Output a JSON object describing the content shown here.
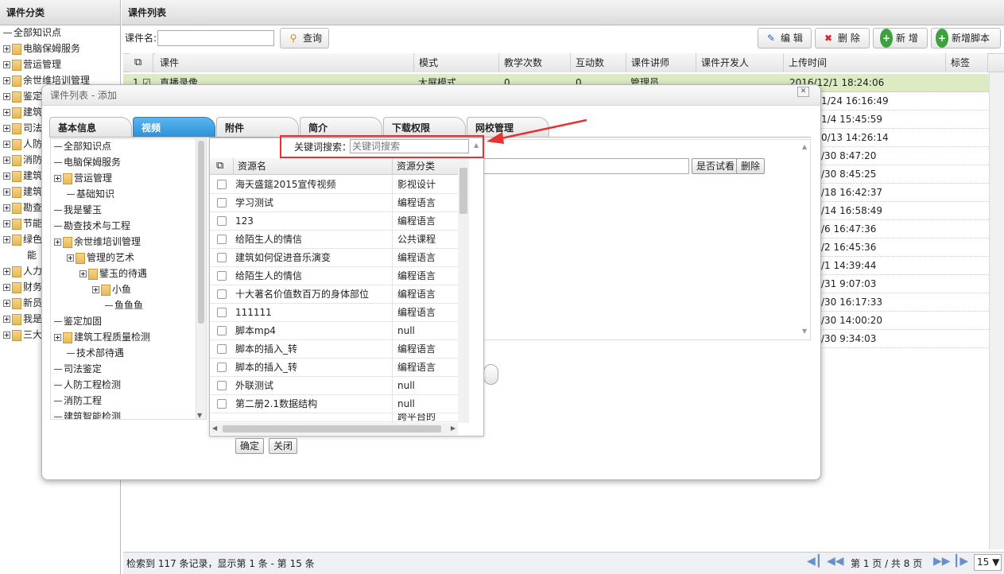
{
  "left_panel": {
    "title": "课件分类",
    "items": [
      {
        "label": "全部知识点",
        "expand": false,
        "folder": false
      },
      {
        "label": "电脑保姆服务",
        "expand": true,
        "folder": true
      },
      {
        "label": "营运管理",
        "expand": true,
        "folder": true
      },
      {
        "label": "余世维培训管理",
        "expand": true,
        "folder": true
      },
      {
        "label": "鉴定",
        "expand": true,
        "folder": true
      },
      {
        "label": "建筑",
        "expand": true,
        "folder": true
      },
      {
        "label": "司法",
        "expand": true,
        "folder": true
      },
      {
        "label": "人防",
        "expand": true,
        "folder": true
      },
      {
        "label": "消防",
        "expand": true,
        "folder": true
      },
      {
        "label": "建筑",
        "expand": true,
        "folder": true
      },
      {
        "label": "建筑",
        "expand": true,
        "folder": true
      },
      {
        "label": "勘查",
        "expand": true,
        "folder": true
      },
      {
        "label": "节能",
        "expand": true,
        "folder": true
      },
      {
        "label": "绿色",
        "expand": true,
        "folder": true
      },
      {
        "label": "能",
        "expand": false,
        "folder": false
      },
      {
        "label": "人力",
        "expand": true,
        "folder": true
      },
      {
        "label": "财务",
        "expand": true,
        "folder": true
      },
      {
        "label": "新员",
        "expand": true,
        "folder": true
      },
      {
        "label": "我是",
        "expand": true,
        "folder": true
      },
      {
        "label": "三大",
        "expand": true,
        "folder": true
      }
    ]
  },
  "main": {
    "title": "课件列表",
    "search_label": "课件名:",
    "search_value": "",
    "search_button": "查询",
    "toolbar": {
      "edit": "编 辑",
      "delete": "删 除",
      "add": "新 增",
      "add_script": "新增脚本"
    },
    "columns": [
      "课件",
      "模式",
      "教学次数",
      "互动数",
      "课件讲师",
      "课件开发人",
      "上传时间",
      "标签"
    ],
    "first_row": {
      "num": "1",
      "name": "直播录像",
      "mode": "大屏模式",
      "teach": "0",
      "interact": "0",
      "lecturer": "管理员"
    },
    "upload_times": [
      "2016/12/1 18:24:06",
      "1/24 16:16:49",
      "1/4 15:45:59",
      "0/13 14:26:14",
      "/30 8:47:20",
      "/30 8:45:25",
      "/18 16:42:37",
      "/14 16:58:49",
      "/6 16:47:36",
      "/2 16:45:36",
      "/1 14:39:44",
      "/31 9:07:03",
      "/30 16:17:33",
      "/30 14:00:20",
      "/30 9:34:03"
    ],
    "footer_text": "检索到 117 条记录，显示第 1 条 - 第 15 条",
    "pager_text": "第 1 页 / 共 8 页",
    "page_size": "15"
  },
  "dialog": {
    "title": "课件列表 - 添加",
    "tabs": [
      "基本信息",
      "视频",
      "附件",
      "简介",
      "下载权限",
      "网校管理"
    ],
    "tree": [
      {
        "label": "全部知识点",
        "expand": false,
        "folder": false,
        "level": 0
      },
      {
        "label": "电脑保姆服务",
        "expand": false,
        "folder": false,
        "level": 0
      },
      {
        "label": "营运管理",
        "expand": true,
        "folder": true,
        "level": 0
      },
      {
        "label": "基础知识",
        "expand": false,
        "folder": false,
        "level": 1
      },
      {
        "label": "我是鐾玉",
        "expand": false,
        "folder": false,
        "level": 0
      },
      {
        "label": "勘查技术与工程",
        "expand": false,
        "folder": false,
        "level": 0
      },
      {
        "label": "余世维培训管理",
        "expand": true,
        "folder": true,
        "level": 0
      },
      {
        "label": "管理的艺术",
        "expand": true,
        "folder": true,
        "level": 1
      },
      {
        "label": "鐾玉的待遇",
        "expand": true,
        "folder": true,
        "level": 2
      },
      {
        "label": "小鱼",
        "expand": true,
        "folder": true,
        "level": 3
      },
      {
        "label": "鱼鱼鱼",
        "expand": false,
        "folder": false,
        "level": 4
      },
      {
        "label": "鉴定加固",
        "expand": false,
        "folder": false,
        "level": 0
      },
      {
        "label": "建筑工程质量检测",
        "expand": true,
        "folder": true,
        "level": 0
      },
      {
        "label": "技术部待遇",
        "expand": false,
        "folder": false,
        "level": 1
      },
      {
        "label": "司法鉴定",
        "expand": false,
        "folder": false,
        "level": 0
      },
      {
        "label": "人防工程检测",
        "expand": false,
        "folder": false,
        "level": 0
      },
      {
        "label": "消防工程",
        "expand": false,
        "folder": false,
        "level": 0
      },
      {
        "label": "建筑智能检测",
        "expand": false,
        "folder": false,
        "level": 0
      }
    ],
    "keyword_label": "关键词搜索：",
    "keyword_placeholder": "关键词搜索",
    "resource_columns": [
      "资源名",
      "资源分类"
    ],
    "resources": [
      {
        "name": "海天盛筵2015宣传视频",
        "cat": "影视设计"
      },
      {
        "name": "学习测试",
        "cat": "编程语言"
      },
      {
        "name": "123",
        "cat": "编程语言"
      },
      {
        "name": "给陌生人的情信",
        "cat": "公共课程"
      },
      {
        "name": "建筑如何促进音乐演变",
        "cat": "编程语言"
      },
      {
        "name": "给陌生人的情信",
        "cat": "编程语言"
      },
      {
        "name": "十大著名价值数百万的身体部位",
        "cat": "编程语言"
      },
      {
        "name": "111111",
        "cat": "编程语言"
      },
      {
        "name": "脚本mp4",
        "cat": "null"
      },
      {
        "name": "脚本的插入_转",
        "cat": "编程语言"
      },
      {
        "name": "脚本的插入_转",
        "cat": "编程语言"
      },
      {
        "name": "外联测试",
        "cat": "null"
      },
      {
        "name": "第二册2.1数据结构",
        "cat": "null"
      },
      {
        "name": "",
        "cat": "跨平台的"
      }
    ],
    "trial_button": "是否试看",
    "remove_button": "删除",
    "confirm_button": "确定",
    "close_button": "关闭"
  },
  "colors": {
    "accent": "#2d8fd6",
    "highlight_row": "#dcebc2",
    "annotation": "#e53333"
  }
}
